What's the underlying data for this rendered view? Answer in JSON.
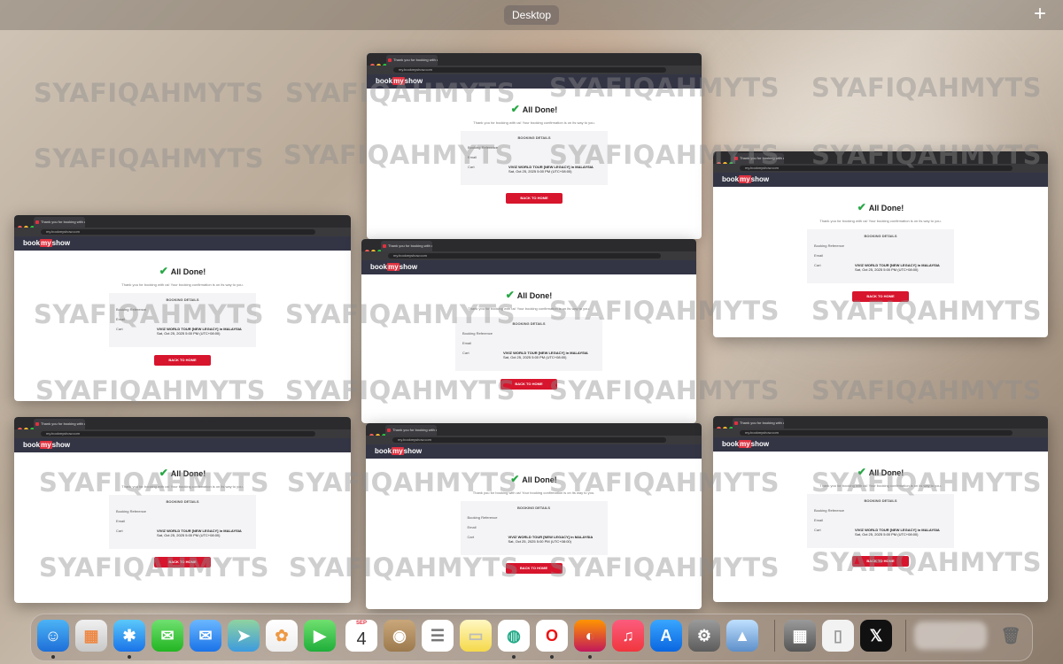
{
  "desktop": {
    "label": "Desktop",
    "add_label": "+"
  },
  "window": {
    "tab_title": "Thank you for booking with us!",
    "url": "my.bookmyshow.com",
    "logo_left": "book",
    "logo_mid": "my",
    "logo_right": "show",
    "heading": "All Done!",
    "thanks": "Thank you for booking with us! Your booking confirmation is on its way to you.",
    "card_title": "BOOKING DETAILS",
    "ref_label": "Booking Reference",
    "email_label": "Email",
    "cart_label": "Cart",
    "cart_event": "VIVIZ WORLD TOUR [NEW LEGACY] in MALAYSIA",
    "cart_date": "Sat, Oct 25, 2025 5:00 PM (UTC+08:00)",
    "button": "BACK TO HOME"
  },
  "watermark": "SYAFIQAHMYTS",
  "dock": {
    "calendar_month": "SEP",
    "calendar_day": "4",
    "apps": [
      "finder-icon",
      "launchpad-icon",
      "safari-icon",
      "messages-icon",
      "mail-icon",
      "maps-icon",
      "photos-icon",
      "facetime-icon",
      "calendar-icon",
      "contacts-icon",
      "reminders-icon",
      "notes-icon",
      "chrome-icon",
      "opera-icon",
      "firefox-icon",
      "music-icon",
      "app-store-icon",
      "system-settings-icon",
      "preview-icon",
      "calculator-icon",
      "document-icon",
      "x-icon",
      "trash-icon"
    ]
  },
  "colors": {
    "brand_red": "#e0313f",
    "button_red": "#d7152d",
    "navbar": "#333545",
    "check_green": "#28a745"
  }
}
